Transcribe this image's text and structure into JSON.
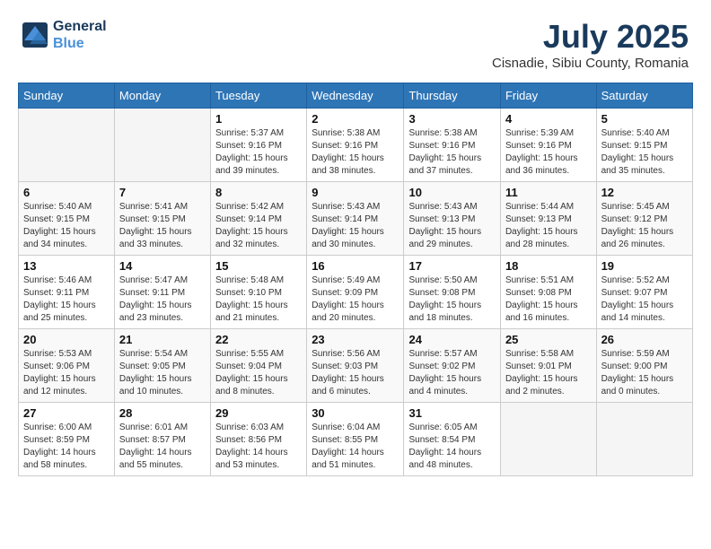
{
  "header": {
    "logo_line1": "General",
    "logo_line2": "Blue",
    "main_title": "July 2025",
    "subtitle": "Cisnadie, Sibiu County, Romania"
  },
  "weekdays": [
    "Sunday",
    "Monday",
    "Tuesday",
    "Wednesday",
    "Thursday",
    "Friday",
    "Saturday"
  ],
  "weeks": [
    [
      {
        "day": "",
        "info": ""
      },
      {
        "day": "",
        "info": ""
      },
      {
        "day": "1",
        "info": "Sunrise: 5:37 AM\nSunset: 9:16 PM\nDaylight: 15 hours\nand 39 minutes."
      },
      {
        "day": "2",
        "info": "Sunrise: 5:38 AM\nSunset: 9:16 PM\nDaylight: 15 hours\nand 38 minutes."
      },
      {
        "day": "3",
        "info": "Sunrise: 5:38 AM\nSunset: 9:16 PM\nDaylight: 15 hours\nand 37 minutes."
      },
      {
        "day": "4",
        "info": "Sunrise: 5:39 AM\nSunset: 9:16 PM\nDaylight: 15 hours\nand 36 minutes."
      },
      {
        "day": "5",
        "info": "Sunrise: 5:40 AM\nSunset: 9:15 PM\nDaylight: 15 hours\nand 35 minutes."
      }
    ],
    [
      {
        "day": "6",
        "info": "Sunrise: 5:40 AM\nSunset: 9:15 PM\nDaylight: 15 hours\nand 34 minutes."
      },
      {
        "day": "7",
        "info": "Sunrise: 5:41 AM\nSunset: 9:15 PM\nDaylight: 15 hours\nand 33 minutes."
      },
      {
        "day": "8",
        "info": "Sunrise: 5:42 AM\nSunset: 9:14 PM\nDaylight: 15 hours\nand 32 minutes."
      },
      {
        "day": "9",
        "info": "Sunrise: 5:43 AM\nSunset: 9:14 PM\nDaylight: 15 hours\nand 30 minutes."
      },
      {
        "day": "10",
        "info": "Sunrise: 5:43 AM\nSunset: 9:13 PM\nDaylight: 15 hours\nand 29 minutes."
      },
      {
        "day": "11",
        "info": "Sunrise: 5:44 AM\nSunset: 9:13 PM\nDaylight: 15 hours\nand 28 minutes."
      },
      {
        "day": "12",
        "info": "Sunrise: 5:45 AM\nSunset: 9:12 PM\nDaylight: 15 hours\nand 26 minutes."
      }
    ],
    [
      {
        "day": "13",
        "info": "Sunrise: 5:46 AM\nSunset: 9:11 PM\nDaylight: 15 hours\nand 25 minutes."
      },
      {
        "day": "14",
        "info": "Sunrise: 5:47 AM\nSunset: 9:11 PM\nDaylight: 15 hours\nand 23 minutes."
      },
      {
        "day": "15",
        "info": "Sunrise: 5:48 AM\nSunset: 9:10 PM\nDaylight: 15 hours\nand 21 minutes."
      },
      {
        "day": "16",
        "info": "Sunrise: 5:49 AM\nSunset: 9:09 PM\nDaylight: 15 hours\nand 20 minutes."
      },
      {
        "day": "17",
        "info": "Sunrise: 5:50 AM\nSunset: 9:08 PM\nDaylight: 15 hours\nand 18 minutes."
      },
      {
        "day": "18",
        "info": "Sunrise: 5:51 AM\nSunset: 9:08 PM\nDaylight: 15 hours\nand 16 minutes."
      },
      {
        "day": "19",
        "info": "Sunrise: 5:52 AM\nSunset: 9:07 PM\nDaylight: 15 hours\nand 14 minutes."
      }
    ],
    [
      {
        "day": "20",
        "info": "Sunrise: 5:53 AM\nSunset: 9:06 PM\nDaylight: 15 hours\nand 12 minutes."
      },
      {
        "day": "21",
        "info": "Sunrise: 5:54 AM\nSunset: 9:05 PM\nDaylight: 15 hours\nand 10 minutes."
      },
      {
        "day": "22",
        "info": "Sunrise: 5:55 AM\nSunset: 9:04 PM\nDaylight: 15 hours\nand 8 minutes."
      },
      {
        "day": "23",
        "info": "Sunrise: 5:56 AM\nSunset: 9:03 PM\nDaylight: 15 hours\nand 6 minutes."
      },
      {
        "day": "24",
        "info": "Sunrise: 5:57 AM\nSunset: 9:02 PM\nDaylight: 15 hours\nand 4 minutes."
      },
      {
        "day": "25",
        "info": "Sunrise: 5:58 AM\nSunset: 9:01 PM\nDaylight: 15 hours\nand 2 minutes."
      },
      {
        "day": "26",
        "info": "Sunrise: 5:59 AM\nSunset: 9:00 PM\nDaylight: 15 hours\nand 0 minutes."
      }
    ],
    [
      {
        "day": "27",
        "info": "Sunrise: 6:00 AM\nSunset: 8:59 PM\nDaylight: 14 hours\nand 58 minutes."
      },
      {
        "day": "28",
        "info": "Sunrise: 6:01 AM\nSunset: 8:57 PM\nDaylight: 14 hours\nand 55 minutes."
      },
      {
        "day": "29",
        "info": "Sunrise: 6:03 AM\nSunset: 8:56 PM\nDaylight: 14 hours\nand 53 minutes."
      },
      {
        "day": "30",
        "info": "Sunrise: 6:04 AM\nSunset: 8:55 PM\nDaylight: 14 hours\nand 51 minutes."
      },
      {
        "day": "31",
        "info": "Sunrise: 6:05 AM\nSunset: 8:54 PM\nDaylight: 14 hours\nand 48 minutes."
      },
      {
        "day": "",
        "info": ""
      },
      {
        "day": "",
        "info": ""
      }
    ]
  ]
}
